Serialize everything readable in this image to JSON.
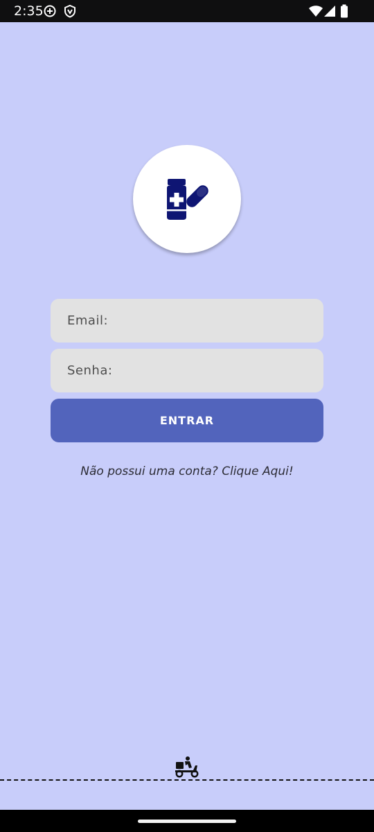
{
  "status_bar": {
    "time": "2:35",
    "left_icons": [
      "add-circle-icon",
      "shield-icon"
    ],
    "right_icons": [
      "wifi-icon",
      "signal-icon",
      "battery-icon"
    ]
  },
  "logo": {
    "icon": "medicine-bottle-pill-icon",
    "icon_color": "#0e1573"
  },
  "form": {
    "email_placeholder": "Email:",
    "password_placeholder": "Senha:",
    "login_label": "ENTRAR",
    "signup_text": "Não possui uma conta? Clique Aqui!"
  },
  "footer": {
    "icon": "delivery-scooter-icon"
  },
  "colors": {
    "background": "#c8cdfa",
    "button": "#5264bc",
    "input": "#e2e2e2"
  }
}
